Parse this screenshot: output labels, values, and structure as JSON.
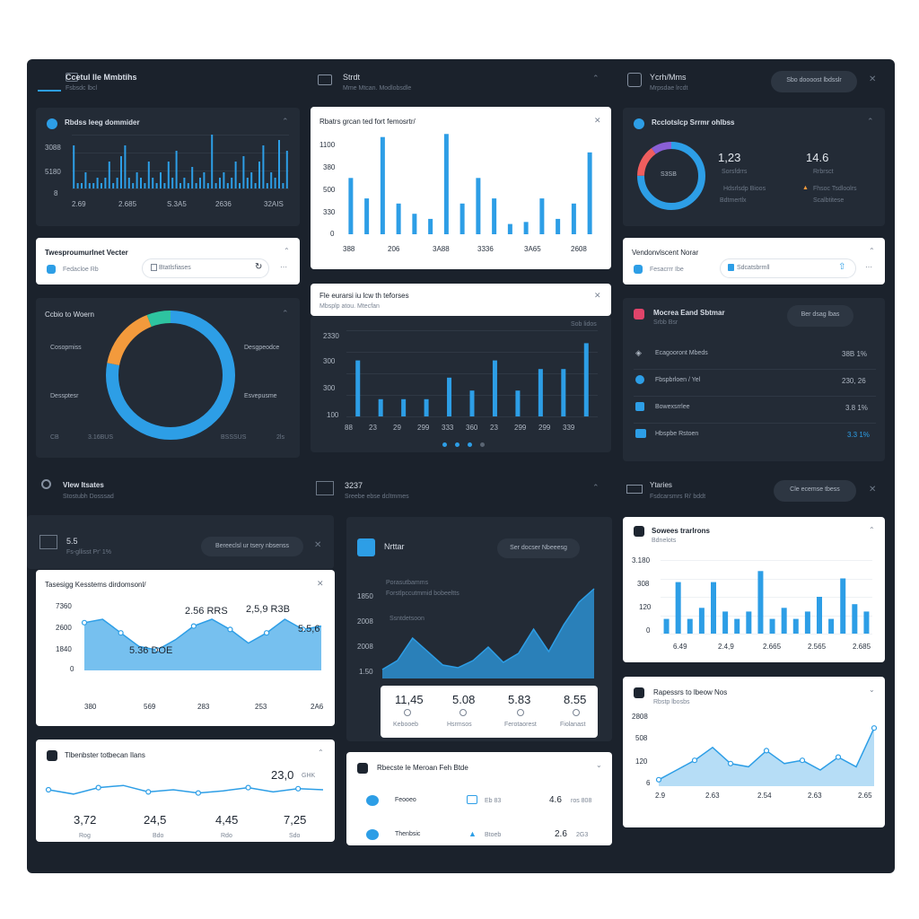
{
  "colors": {
    "bg": "#1b222c",
    "panel": "#232b36",
    "accent": "#2d9ee6",
    "orange": "#f39a3c",
    "green": "#2ec4a0",
    "red": "#ef5e5e"
  },
  "top": {
    "col1": {
      "title": "Ccetul lle Mmbtihs",
      "sub": "Fsbsdc lbcl"
    },
    "col2": {
      "title": "Strdt",
      "sub": "Mme Mtcan. Modlobsdle"
    },
    "col3": {
      "title": "Ycrh/Mms",
      "sub": "Mrpsdae lrcdt",
      "button": "Sbo doooost lbdsslr"
    }
  },
  "p1": {
    "title": "Rbdss leeg dommider",
    "yticks": [
      "3088",
      "5180",
      "8"
    ],
    "xticks": [
      "2.69",
      "2.685",
      "S.3A5",
      "2636",
      "32AIS"
    ]
  },
  "p2": {
    "title": "Rbatrs grcan ted fort femosrtr/",
    "yticks": [
      "1100",
      "380",
      "500",
      "330",
      "0"
    ],
    "xticks": [
      "388",
      "206",
      "3A88",
      "3336",
      "3A65",
      "2608"
    ]
  },
  "p3": {
    "title": "Rcclotslcp Srrmr ohlbss",
    "donut_center": "S3SB",
    "stat1": "1,23",
    "stat1_sub": "Sorsfdrrs",
    "stat1_note": "Hdsrlsdp Bioos",
    "stat1_note2": "Bdtmertlx",
    "stat2": "14.6",
    "stat2_sub": "Rrbrsct",
    "stat2_note": "Fhsoc Tsdloolrs",
    "stat2_note2": "Scalbtitese"
  },
  "p4": {
    "title": "Twesproumurlnet Vecter",
    "sub": "Fedacloe Rb",
    "input": "Btatlsfiases"
  },
  "p5": {
    "title": "Vendonvlscent Norar",
    "sub": "Fesacrrr Ibe",
    "input": "Sdcatsbrmll"
  },
  "p6": {
    "title": "Ccbio to Woern",
    "labels": [
      "Cosopmiss",
      "Dessptesr",
      "Desgpeodce",
      "Esvepusme"
    ],
    "foot": [
      "CB",
      "3.16BUS",
      "BSSSUS",
      "2ls"
    ]
  },
  "p7": {
    "title": "Fle eurarsi iu lcw th teforses",
    "sub": "Mbsplp atou. Mtecfan",
    "corner": "Sob lidos",
    "yticks": [
      "2330",
      "300",
      "300",
      "100"
    ],
    "xticks": [
      "88",
      "23",
      "29",
      "299",
      "333",
      "360",
      "23",
      "299",
      "299",
      "339"
    ]
  },
  "p8": {
    "title": "Mocrea Eand Sbtmar",
    "sub": "Srbb Bsr",
    "button": "Ber dsag lbas",
    "rows": [
      {
        "label": "Ecagooront Mbeds",
        "value": "38B 1%"
      },
      {
        "label": "Fbspbrloen / Yel",
        "value": "230, 26"
      },
      {
        "label": "Bowexsrrlee",
        "value": "3.8 1%"
      },
      {
        "label": "Hbspbe Rstoen",
        "value": "3.3 1%"
      }
    ]
  },
  "mid": {
    "col1": {
      "title": "Vlew Itsates",
      "sub": "Stostubh Dosssad"
    },
    "col2": {
      "title": "3237",
      "sub": "Sreebe ebse dcltmmes"
    },
    "col3": {
      "title": "Ytaries",
      "sub": "Fsdcarsmrs Ri' bddt",
      "button": "Cle ecemse tbess"
    }
  },
  "p9": {
    "title": "5.5",
    "sub": "Fs-gllisst Pr' 1%",
    "button": "Bereeclsl ur tsery nbsenss"
  },
  "p10": {
    "title": "Tasesigg Kesstems dirdomsonl/",
    "yticks": [
      "7360",
      "2600",
      "1840",
      "0"
    ],
    "xticks": [
      "380",
      "569",
      "283",
      "253",
      "2A6"
    ],
    "callouts": [
      "2.56 RRS",
      "2,5,9 R3B",
      "5.5,6",
      "5.36 DOE"
    ]
  },
  "p11": {
    "title": "Nrttar",
    "button": "Ser docser Nbeeesg",
    "lines": [
      "Porasutbamms",
      "Forstlpccutmmid bobeeltts",
      "Ssntdetsoon"
    ],
    "yticks": [
      "1850",
      "2008",
      "2008",
      "1.50"
    ],
    "stats": [
      {
        "value": "11,45",
        "label": "Kebooeb"
      },
      {
        "value": "5.08",
        "label": "Hsrmsos"
      },
      {
        "value": "5.83",
        "label": "Ferotaorest"
      },
      {
        "value": "8.55",
        "label": "Fiolanast"
      }
    ]
  },
  "p12": {
    "title": "Sowees trarlrons",
    "sub": "Bdnelots",
    "yticks": [
      "3.180",
      "308",
      "120",
      "0"
    ],
    "xticks": [
      "6.49",
      "2.4,9",
      "2.665",
      "2.565",
      "2.685"
    ]
  },
  "p13": {
    "title": "Tlbenbster totbecan Ilans",
    "big": "23,0",
    "big_unit": "GHK",
    "stats": [
      "3,72",
      "24,5",
      "4,45",
      "7,25"
    ],
    "statlbl": [
      "Rog",
      "Bdo",
      "Rdo",
      "Sdo"
    ]
  },
  "p14": {
    "title": "Rbecste le Meroan Feh Btde",
    "rows": [
      {
        "label": "Feooeo",
        "mid": "Eb 83",
        "value": "4.6",
        "note": "ros 808"
      },
      {
        "label": "Thenbsic",
        "mid": "Btoeb",
        "value": "2.6",
        "note": "2G3"
      }
    ]
  },
  "p15": {
    "title": "Rapessrs to lbeow Nos",
    "sub": "Rbstp lbosbs",
    "yticks": [
      "2808",
      "508",
      "120",
      "6"
    ],
    "xticks": [
      "2.9",
      "2.63",
      "2.54",
      "2.63",
      "2.65"
    ]
  },
  "chart_data": [
    {
      "type": "bar",
      "title": "Rbdss leeg dommider",
      "values": [
        0.8,
        0.1,
        0.1,
        0.3,
        0.1,
        0.1,
        0.2,
        0.1,
        0.2,
        0.5,
        0.1,
        0.2,
        0.6,
        0.8,
        0.2,
        0.1,
        0.3,
        0.2,
        0.1,
        0.5,
        0.2,
        0.1,
        0.3,
        0.1,
        0.5,
        0.2,
        0.7,
        0.1,
        0.2,
        0.1,
        0.4,
        0.1,
        0.2,
        0.3,
        0.1,
        1.0,
        0.1,
        0.2,
        0.3,
        0.1,
        0.2,
        0.5,
        0.1,
        0.6,
        0.2,
        0.3,
        0.1,
        0.5,
        0.8,
        0.1,
        0.3,
        0.2,
        0.9,
        0.1,
        0.7
      ]
    },
    {
      "type": "bar",
      "title": "Rbatrs grcan ted fort femosrtr/",
      "values": [
        0.55,
        0.35,
        0.95,
        0.3,
        0.2,
        0.15,
        0.98,
        0.3,
        0.55,
        0.35,
        0.1,
        0.12,
        0.35,
        0.15,
        0.3,
        0.8
      ]
    },
    {
      "type": "pie",
      "title": "Rcclotslcp Srrmr ohlbss",
      "values": [
        75,
        15,
        10
      ]
    },
    {
      "type": "pie",
      "title": "Ccbio to Woern",
      "values": [
        78,
        16,
        6
      ]
    },
    {
      "type": "bar",
      "title": "Fle eurarsi iu lcw th teforses",
      "values": [
        0.65,
        0.2,
        0.2,
        0.2,
        0.45,
        0.3,
        0.65,
        0.3,
        0.55,
        0.55,
        0.85
      ]
    },
    {
      "type": "area",
      "title": "Tasesigg Kesstems dirdomsonl/",
      "values": [
        0.7,
        0.75,
        0.55,
        0.35,
        0.3,
        0.45,
        0.65,
        0.75,
        0.6,
        0.4,
        0.55,
        0.75,
        0.6,
        0.65
      ]
    },
    {
      "type": "line",
      "title": "Nrttar",
      "values": [
        0.1,
        0.2,
        0.45,
        0.3,
        0.15,
        0.12,
        0.2,
        0.35,
        0.18,
        0.28,
        0.55,
        0.3,
        0.6,
        0.85,
        1.0
      ]
    },
    {
      "type": "bar",
      "title": "Sowees trarlrons",
      "values": [
        0.2,
        0.7,
        0.2,
        0.35,
        0.7,
        0.3,
        0.2,
        0.3,
        0.85,
        0.2,
        0.35,
        0.2,
        0.3,
        0.5,
        0.2,
        0.75,
        0.4,
        0.3
      ]
    },
    {
      "type": "line",
      "title": "Rapessrs to lbeow Nos",
      "values": [
        0.1,
        0.25,
        0.4,
        0.6,
        0.35,
        0.3,
        0.55,
        0.35,
        0.4,
        0.25,
        0.45,
        0.3,
        0.9
      ]
    },
    {
      "type": "line",
      "title": "Tlbenbster totbecan Ilans",
      "values": [
        0.5,
        0.3,
        0.6,
        0.7,
        0.4,
        0.5,
        0.35,
        0.45,
        0.6,
        0.4,
        0.55,
        0.5
      ]
    }
  ]
}
